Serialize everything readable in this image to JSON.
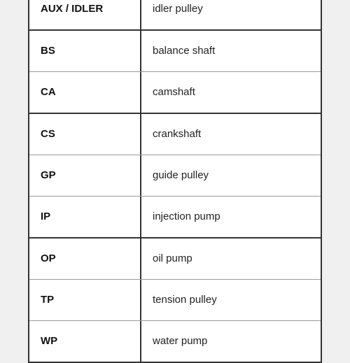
{
  "table": {
    "rows": [
      {
        "code": "AUX / IDLER",
        "description": "idler pulley",
        "thick": true
      },
      {
        "code": "BS",
        "description": "balance shaft",
        "thick": false
      },
      {
        "code": "CA",
        "description": "camshaft",
        "thick": true
      },
      {
        "code": "CS",
        "description": "crankshaft",
        "thick": false
      },
      {
        "code": "GP",
        "description": "guide pulley",
        "thick": false
      },
      {
        "code": "IP",
        "description": "injection pump",
        "thick": true
      },
      {
        "code": "OP",
        "description": "oil pump",
        "thick": false
      },
      {
        "code": "TP",
        "description": "tension pulley",
        "thick": false
      },
      {
        "code": "WP",
        "description": "water pump",
        "thick": false
      }
    ]
  }
}
